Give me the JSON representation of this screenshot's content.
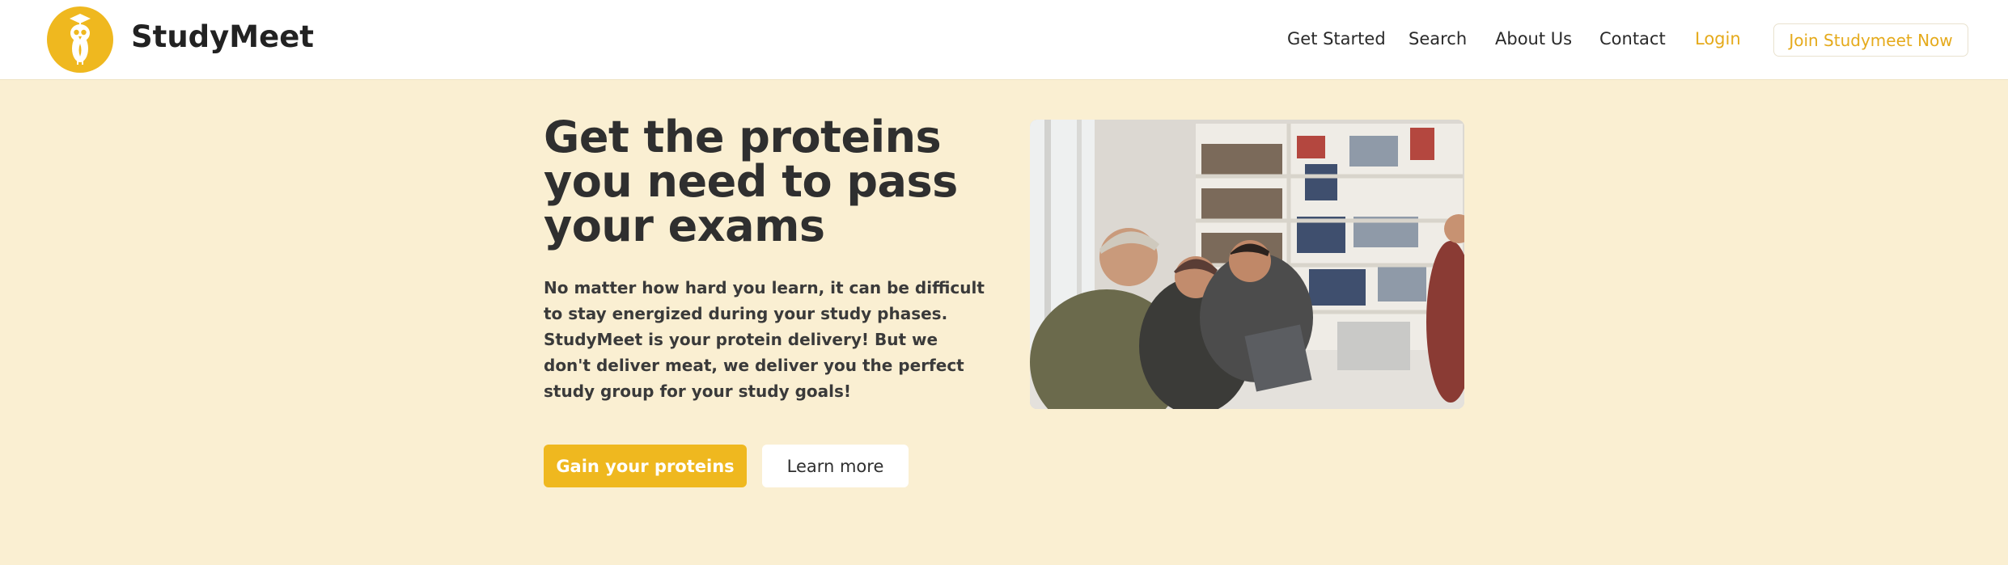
{
  "header": {
    "brand": "StudyMeet",
    "logo_icon": "owl-graduation-cap-icon",
    "nav": [
      "Get Started",
      "Search",
      "About Us",
      "Contact"
    ],
    "login": "Login",
    "join": "Join Studymeet Now"
  },
  "hero": {
    "headline": "Get the proteins you need to pass your exams",
    "description": "No matter how hard you learn, it can be difficult to stay energized during your study phases. StudyMeet is your protein delivery! But we don't deliver meat, we deliver you the perfect study group for your study goals!",
    "primary_button": "Gain your proteins",
    "secondary_button": "Learn more"
  },
  "colors": {
    "accent": "#efb81f",
    "background": "#faefd2"
  }
}
